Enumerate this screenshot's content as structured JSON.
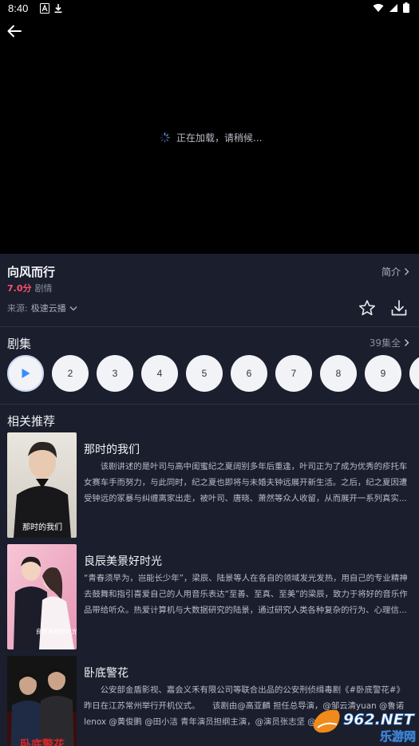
{
  "status_bar": {
    "time": "8:40"
  },
  "player": {
    "loading_text": "正在加载，请稍候..."
  },
  "info": {
    "title": "向风而行",
    "intro_label": "简介",
    "score": "7.0分",
    "genre": "剧情",
    "source_label": "来源:",
    "source_value": "极速云播"
  },
  "episodes": {
    "header": "剧集",
    "total": "39集全",
    "items": [
      "2",
      "3",
      "4",
      "5",
      "6",
      "7",
      "8",
      "9"
    ]
  },
  "recommend": {
    "header": "相关推荐",
    "items": [
      {
        "title": "那时的我们",
        "desc": "　　该剧讲述的是叶司与高中闺蜜纪之夏阔别多年后重逢，叶司正为了成为优秀的疹托车女赛车手而努力，与此同时，纪之夏也即将与未婚夫钟远展开新生活。之后，纪之夏因遭受钟远的冢暴与纠缠离家出走，被叶司、唐晓、萧然等众人收留，从而展开一系列真实...",
        "poster_text": "那时的我们"
      },
      {
        "title": "良辰美景好时光",
        "desc": "“青春须早为，岂能长少年”，梁辰、陆景等人在各自的领域发光发热，用自己的专业精神去鼓舞和指引喜爱自己的人用音乐表达“至善、至真、至美”的梁辰，致力于将好的音乐作品带给听众。热爱计算机与大数据研究的陆景，通过研究人类各种复杂的行为、心理信...",
        "poster_text": "良辰美景好时光"
      },
      {
        "title": "卧底警花",
        "desc": "　　公安部金盾影视、嘉会义禾有限公司等联合出品的公安刑侦缉毒剧《#卧底警花#》昨日在江苏常州举行开机仪式。　　该剧由@高亚麟 担任总导演，@邹云清yuan @鲁诺lenox @黄俊鹏 @田小洁 青年演员担纲主演，@演员张志坚 @...",
        "poster_text": "卧底警花"
      }
    ]
  },
  "watermark": {
    "brand": "962.NET",
    "site": "乐游网"
  },
  "colors": {
    "background": "#1b1e2c",
    "accent_play": "#3a8dff",
    "score": "#ff4f6e"
  }
}
